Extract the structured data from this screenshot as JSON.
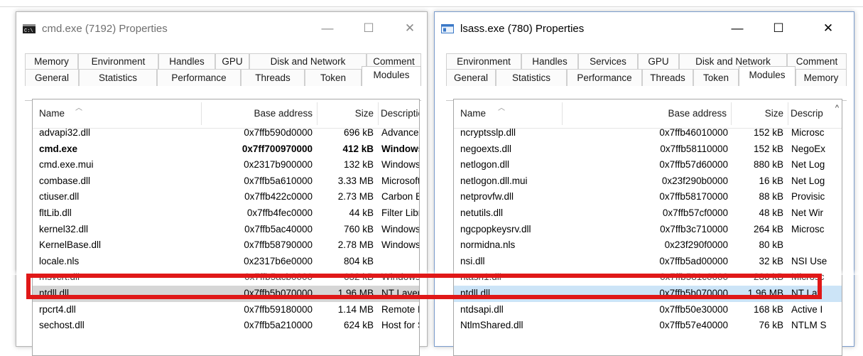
{
  "colors": {
    "highlight_red": "#e01818",
    "selection_blue": "#cce4f7",
    "selection_grey": "#d6d6d6"
  },
  "window_controls": {
    "minimize": "—",
    "maximize": "☐",
    "close": "✕"
  },
  "left_window": {
    "title": "cmd.exe (7192) Properties",
    "icon": "cmd-console-icon",
    "tabs_row1": [
      "Memory",
      "Environment",
      "Handles",
      "GPU",
      "Disk and Network",
      "Comment"
    ],
    "tabs_row2": [
      "General",
      "Statistics",
      "Performance",
      "Threads",
      "Token",
      "Modules"
    ],
    "active_tab": "Modules",
    "columns": [
      "Name",
      "Base address",
      "Size",
      "Description"
    ],
    "rows": [
      {
        "name": "advapi32.dll",
        "base": "0x7ffb590d0000",
        "size": "696 kB",
        "desc": "Advanced"
      },
      {
        "name": "cmd.exe",
        "base": "0x7ff700970000",
        "size": "412 kB",
        "desc": "Windows",
        "bold": true
      },
      {
        "name": "cmd.exe.mui",
        "base": "0x2317b900000",
        "size": "132 kB",
        "desc": "Windows C"
      },
      {
        "name": "combase.dll",
        "base": "0x7ffb5a610000",
        "size": "3.33 MB",
        "desc": "Microsoft C"
      },
      {
        "name": "ctiuser.dll",
        "base": "0x7ffb422c0000",
        "size": "2.73 MB",
        "desc": "Carbon Bla"
      },
      {
        "name": "fltLib.dll",
        "base": "0x7ffb4fec0000",
        "size": "44 kB",
        "desc": "Filter Librar"
      },
      {
        "name": "kernel32.dll",
        "base": "0x7ffb5ac40000",
        "size": "760 kB",
        "desc": "Windows N"
      },
      {
        "name": "KernelBase.dll",
        "base": "0x7ffb58790000",
        "size": "2.78 MB",
        "desc": "Windows N"
      },
      {
        "name": "locale.nls",
        "base": "0x2317b6e0000",
        "size": "804 kB",
        "desc": ""
      },
      {
        "name": "msvcrt.dll",
        "base": "0x7ffb5acb0000",
        "size": "632 kB",
        "desc": "Windows N",
        "faded": true
      },
      {
        "name": "ntdll.dll",
        "base": "0x7ffb5b070000",
        "size": "1.96 MB",
        "desc": "NT Layer D",
        "selected": true
      },
      {
        "name": "rpcrt4.dll",
        "base": "0x7ffb59180000",
        "size": "1.14 MB",
        "desc": "Remote Pr"
      },
      {
        "name": "sechost.dll",
        "base": "0x7ffb5a210000",
        "size": "624 kB",
        "desc": "Host for SC"
      }
    ]
  },
  "right_window": {
    "title": "lsass.exe (780) Properties",
    "icon": "app-window-icon",
    "tabs_row1": [
      "Environment",
      "Handles",
      "Services",
      "GPU",
      "Disk and Network",
      "Comment"
    ],
    "tabs_row2": [
      "General",
      "Statistics",
      "Performance",
      "Threads",
      "Token",
      "Modules",
      "Memory"
    ],
    "active_tab": "Modules",
    "columns": [
      "Name",
      "Base address",
      "Size",
      "Descrip"
    ],
    "rows": [
      {
        "name": "ncryptsslp.dll",
        "base": "0x7ffb46010000",
        "size": "152 kB",
        "desc": "Microsc"
      },
      {
        "name": "negoexts.dll",
        "base": "0x7ffb58110000",
        "size": "152 kB",
        "desc": "NegoEx"
      },
      {
        "name": "netlogon.dll",
        "base": "0x7ffb57d60000",
        "size": "880 kB",
        "desc": "Net Log"
      },
      {
        "name": "netlogon.dll.mui",
        "base": "0x23f290b0000",
        "size": "16 kB",
        "desc": "Net Log"
      },
      {
        "name": "netprovfw.dll",
        "base": "0x7ffb58170000",
        "size": "88 kB",
        "desc": "Provisic"
      },
      {
        "name": "netutils.dll",
        "base": "0x7ffb57cf0000",
        "size": "48 kB",
        "desc": "Net Wir"
      },
      {
        "name": "ngcpopkeysrv.dll",
        "base": "0x7ffb3c710000",
        "size": "264 kB",
        "desc": "Microsc"
      },
      {
        "name": "normidna.nls",
        "base": "0x23f290f0000",
        "size": "80 kB",
        "desc": ""
      },
      {
        "name": "nsi.dll",
        "base": "0x7ffb5ad00000",
        "size": "32 kB",
        "desc": "NSI Use"
      },
      {
        "name": "ntasn1.dll",
        "base": "0x7ffb581c0000",
        "size": "236 kB",
        "desc": "Microsc",
        "faded": true
      },
      {
        "name": "ntdll.dll",
        "base": "0x7ffb5b070000",
        "size": "1.96 MB",
        "desc": "NT Lay",
        "selected": true
      },
      {
        "name": "ntdsapi.dll",
        "base": "0x7ffb50e30000",
        "size": "168 kB",
        "desc": "Active I"
      },
      {
        "name": "NtlmShared.dll",
        "base": "0x7ffb57e40000",
        "size": "76 kB",
        "desc": "NTLM S"
      }
    ]
  }
}
